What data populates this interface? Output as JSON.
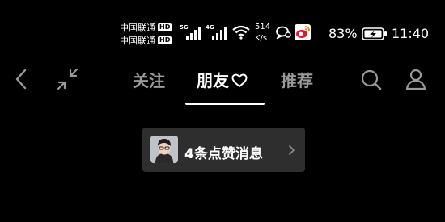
{
  "status_bar": {
    "carrier_1": "中国联通",
    "carrier_2": "中国联通",
    "hd_badge": "HD",
    "network_1": "5G",
    "network_2": "4G",
    "speed_value": "514",
    "speed_unit": "K/s",
    "battery_percent": "83%",
    "time": "11:40"
  },
  "nav": {
    "tabs": [
      {
        "label": "关注",
        "active": false
      },
      {
        "label": "朋友",
        "active": true
      },
      {
        "label": "推荐",
        "active": false
      }
    ],
    "icons": [
      "chevron-left-icon",
      "collapse-icon",
      "heart-icon",
      "search-icon",
      "user-icon"
    ]
  },
  "notification": {
    "text": "4条点赞消息"
  },
  "colors": {
    "background": "#000000",
    "active_tab": "#ffffff",
    "inactive_tab": "#9a9a9a",
    "pill_background": "#2e2e2e"
  }
}
